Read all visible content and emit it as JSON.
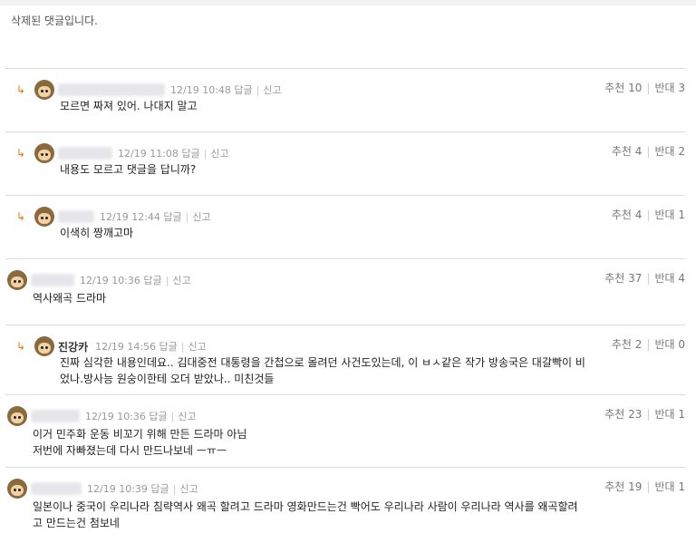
{
  "deleted_notice": "삭제된 댓글입니다.",
  "labels": {
    "reply": "답글",
    "report": "신고",
    "up": "추천",
    "down": "반대"
  },
  "comments": [
    {
      "nickname": "",
      "time": "12/19 10:48",
      "up": "10",
      "down": "3",
      "lines": [
        "모르면 짜져 있어. 나대지 말고"
      ]
    },
    {
      "nickname": "",
      "time": "12/19 11:08",
      "up": "4",
      "down": "2",
      "lines": [
        "내용도 모르고 댓글을 답니까?"
      ]
    },
    {
      "nickname": "",
      "time": "12/19 12:44",
      "up": "4",
      "down": "1",
      "lines": [
        "이색히 짱깨고마"
      ]
    },
    {
      "nickname": "",
      "time": "12/19 10:36",
      "up": "37",
      "down": "4",
      "lines": [
        "역사왜곡 드라마"
      ]
    },
    {
      "nickname": "진강카",
      "time": "12/19 14:56",
      "up": "2",
      "down": "0",
      "lines": [
        "진짜 심각한 내용인데요.. 김대중전 대통령을 간첩으로 몰려던 사건도있는데, 이 ㅂㅅ같은 작가 방송국은 대갈빡이 비",
        "었나.방사능 원숭이한테 오더 받았나.. 미친것들"
      ]
    },
    {
      "nickname": "",
      "time": "12/19 10:36",
      "up": "23",
      "down": "1",
      "lines": [
        "이거 민주화 운동 비꼬기 위해 만든 드라마 아님",
        "저번에 자빠졌는데 다시 만드나보네 ㅡㅠㅡ"
      ]
    },
    {
      "nickname": "",
      "time": "12/19 10:39",
      "up": "19",
      "down": "1",
      "lines": [
        "일본이나 중국이 우리나라 침략역사 왜곡 할려고 드라마 영화만드는건 빡어도 우리나라 사람이 우리나라 역사를 왜곡할려",
        "고 만드는건 첨보네"
      ]
    }
  ]
}
